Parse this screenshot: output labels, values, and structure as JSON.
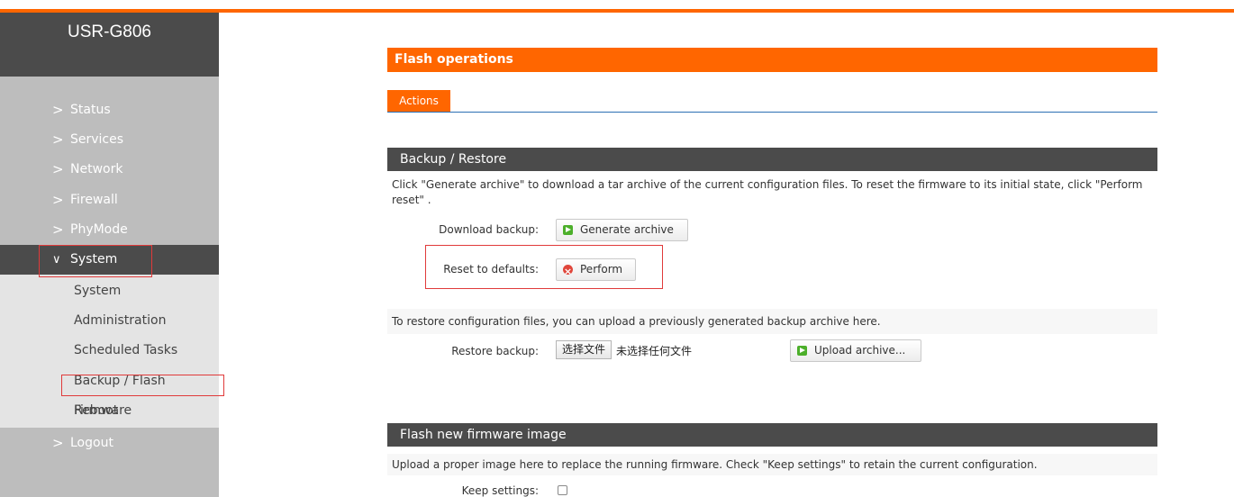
{
  "brand": "USR-G806",
  "nav": {
    "items": [
      {
        "label": "Status"
      },
      {
        "label": "Services"
      },
      {
        "label": "Network"
      },
      {
        "label": "Firewall"
      },
      {
        "label": "PhyMode"
      },
      {
        "label": "System"
      },
      {
        "label": "Logout"
      }
    ],
    "chevron_collapsed": ">",
    "chevron_expanded": "∨",
    "system_submenu": [
      {
        "label": "System"
      },
      {
        "label": "Administration"
      },
      {
        "label": "Scheduled Tasks"
      },
      {
        "label": "Backup / Flash Firmware"
      },
      {
        "label": "Reboot"
      }
    ]
  },
  "page": {
    "title": "Flash operations",
    "tab": "Actions"
  },
  "backup": {
    "header": "Backup / Restore",
    "description": "Click \"Generate archive\" to download a tar archive of the current configuration files. To reset the firmware to its initial state, click \"Perform reset\" .",
    "download_label": "Download backup:",
    "generate_button": "Generate archive",
    "reset_label": "Reset to defaults:",
    "perform_button": "Perform",
    "restore_description": "To restore configuration files, you can upload a previously generated backup archive here.",
    "restore_label": "Restore backup:",
    "file_button": "选择文件",
    "file_none": "未选择任何文件",
    "upload_button": "Upload archive..."
  },
  "flash": {
    "header": "Flash new firmware image",
    "description": "Upload a proper image here to replace the running firmware. Check \"Keep settings\" to retain the current configuration.",
    "keep_label": "Keep settings:",
    "keep_checked": false
  },
  "colors": {
    "accent": "#ff6600",
    "sidebar": "#bdbdbd",
    "dark": "#4b4b4b",
    "highlight": "#e03a3a"
  }
}
